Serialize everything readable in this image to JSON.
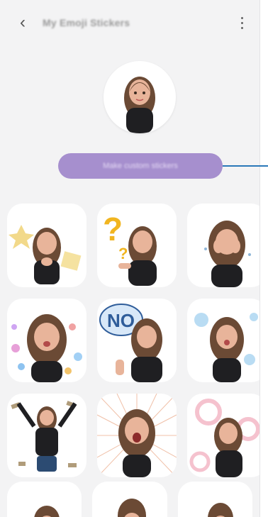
{
  "header": {
    "back_icon": "chevron-left-icon",
    "title": "My Emoji Stickers",
    "more_icon": "more-vertical-icon"
  },
  "profile": {
    "avatar": "emoji-avatar"
  },
  "actions": {
    "make_custom_label": "Make custom stickers"
  },
  "colors": {
    "background": "#f3f3f4",
    "button": "#a68fce",
    "callout": "#2a78b8",
    "hair": "#6b4a35",
    "skin": "#e8b49a",
    "shirt": "#1f1f22"
  },
  "stickers": [
    {
      "id": "sticker-1",
      "desc": "hands-together"
    },
    {
      "id": "sticker-2",
      "desc": "question-marks"
    },
    {
      "id": "sticker-3",
      "desc": "hands-on-face"
    },
    {
      "id": "sticker-4",
      "desc": "celebration"
    },
    {
      "id": "sticker-5",
      "desc": "no-speech-bubble",
      "text": "NO"
    },
    {
      "id": "sticker-6",
      "desc": "kiss"
    },
    {
      "id": "sticker-7",
      "desc": "arms-up-money"
    },
    {
      "id": "sticker-8",
      "desc": "surprised-burst"
    },
    {
      "id": "sticker-9",
      "desc": "bubbles"
    },
    {
      "id": "sticker-10",
      "desc": "partial"
    },
    {
      "id": "sticker-11",
      "desc": "partial"
    },
    {
      "id": "sticker-12",
      "desc": "partial"
    }
  ]
}
